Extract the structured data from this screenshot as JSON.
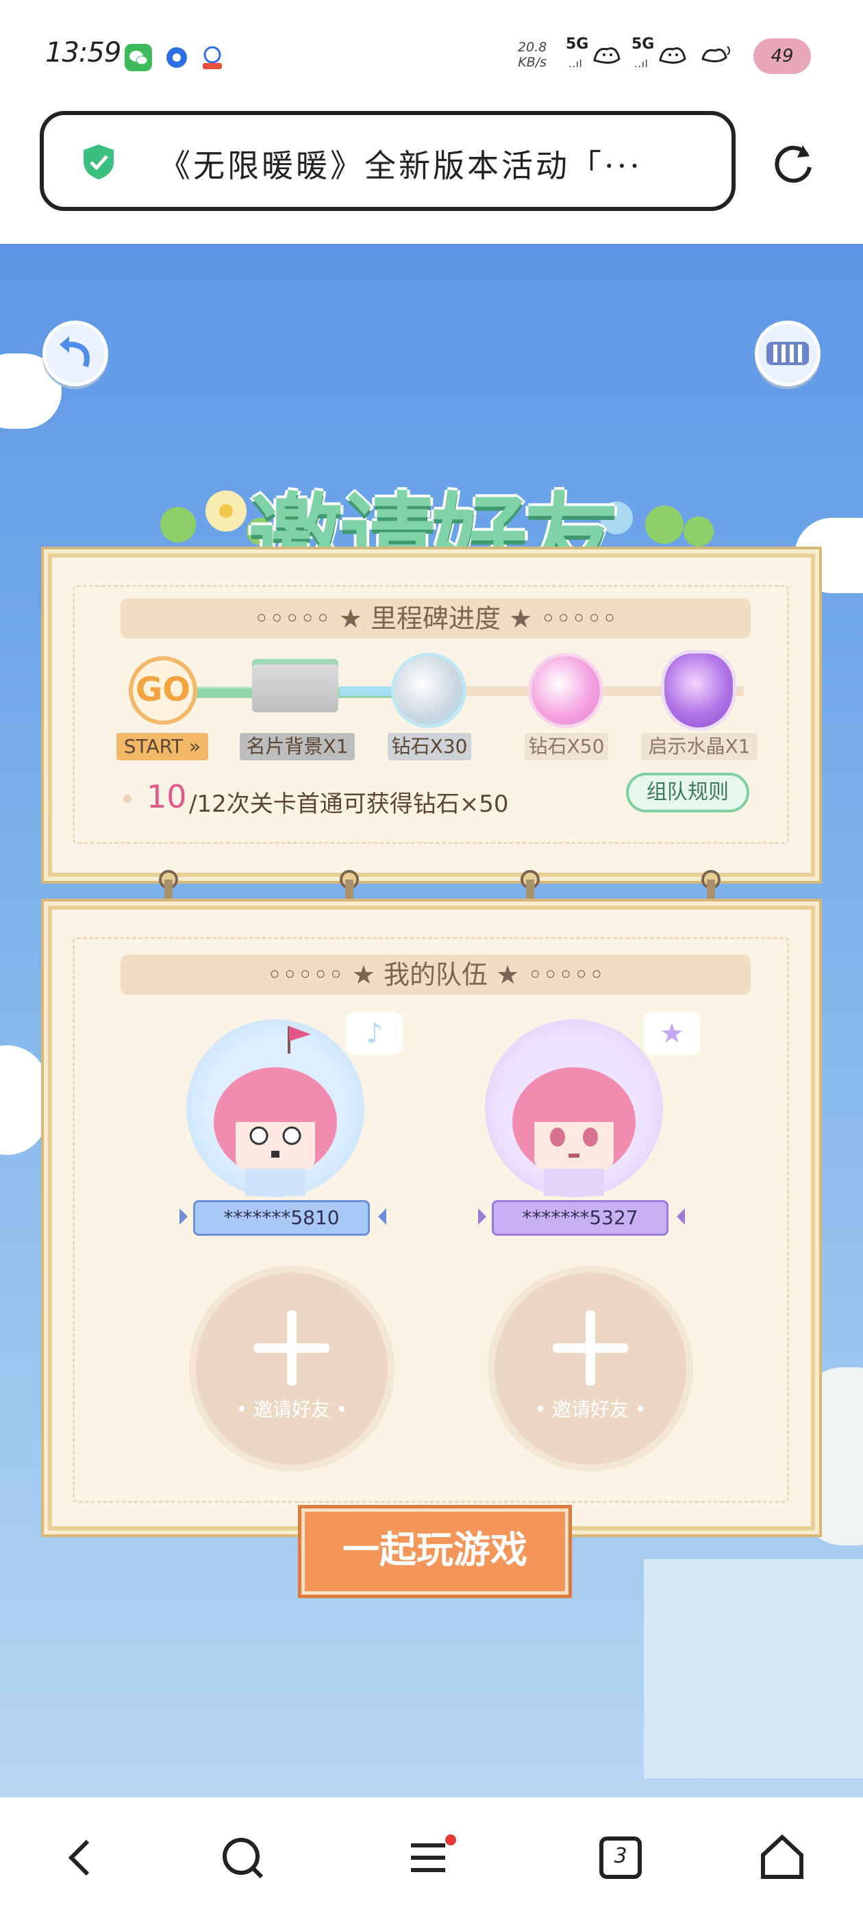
{
  "status_bar": {
    "time": "13:59",
    "net_speed_value": "20.8",
    "net_speed_unit": "KB/s",
    "signal_1": "5G",
    "signal_2": "5G",
    "battery": "49"
  },
  "browser": {
    "url_title": "《无限暖暖》全新版本活动「···",
    "shield_icon": "shield-check-icon",
    "reload_icon": "reload-icon"
  },
  "game": {
    "title": "邀请好友",
    "milestone_header": "◦◦◦◦◦ ★ 里程碑进度 ★ ◦◦◦◦◦",
    "milestones": [
      {
        "label": "START »",
        "icon": "go-badge"
      },
      {
        "label": "名片背景X1",
        "icon": "card-background"
      },
      {
        "label": "钻石X30",
        "icon": "diamond-white"
      },
      {
        "label": "钻石X50",
        "icon": "diamond-pink"
      },
      {
        "label": "启示水晶X1",
        "icon": "crystal-purple"
      }
    ],
    "progress_current": "10",
    "progress_text": "/12次关卡首通可获得钻石×50",
    "rules_button": "组队规则",
    "team_header": "◦◦◦◦◦ ★ 我的队伍 ★ ◦◦◦◦◦",
    "members": [
      {
        "name": "*******5810"
      },
      {
        "name": "*******5327"
      }
    ],
    "invite_label_1": "• 邀请好友 •",
    "invite_label_2": "• 邀请好友 •",
    "play_button": "一起玩游戏"
  },
  "nav": {
    "tabs_count": "3"
  },
  "colors": {
    "title_green": "#7fd3a6",
    "play_orange": "#f4965a",
    "progress_pink": "#e3568a"
  }
}
